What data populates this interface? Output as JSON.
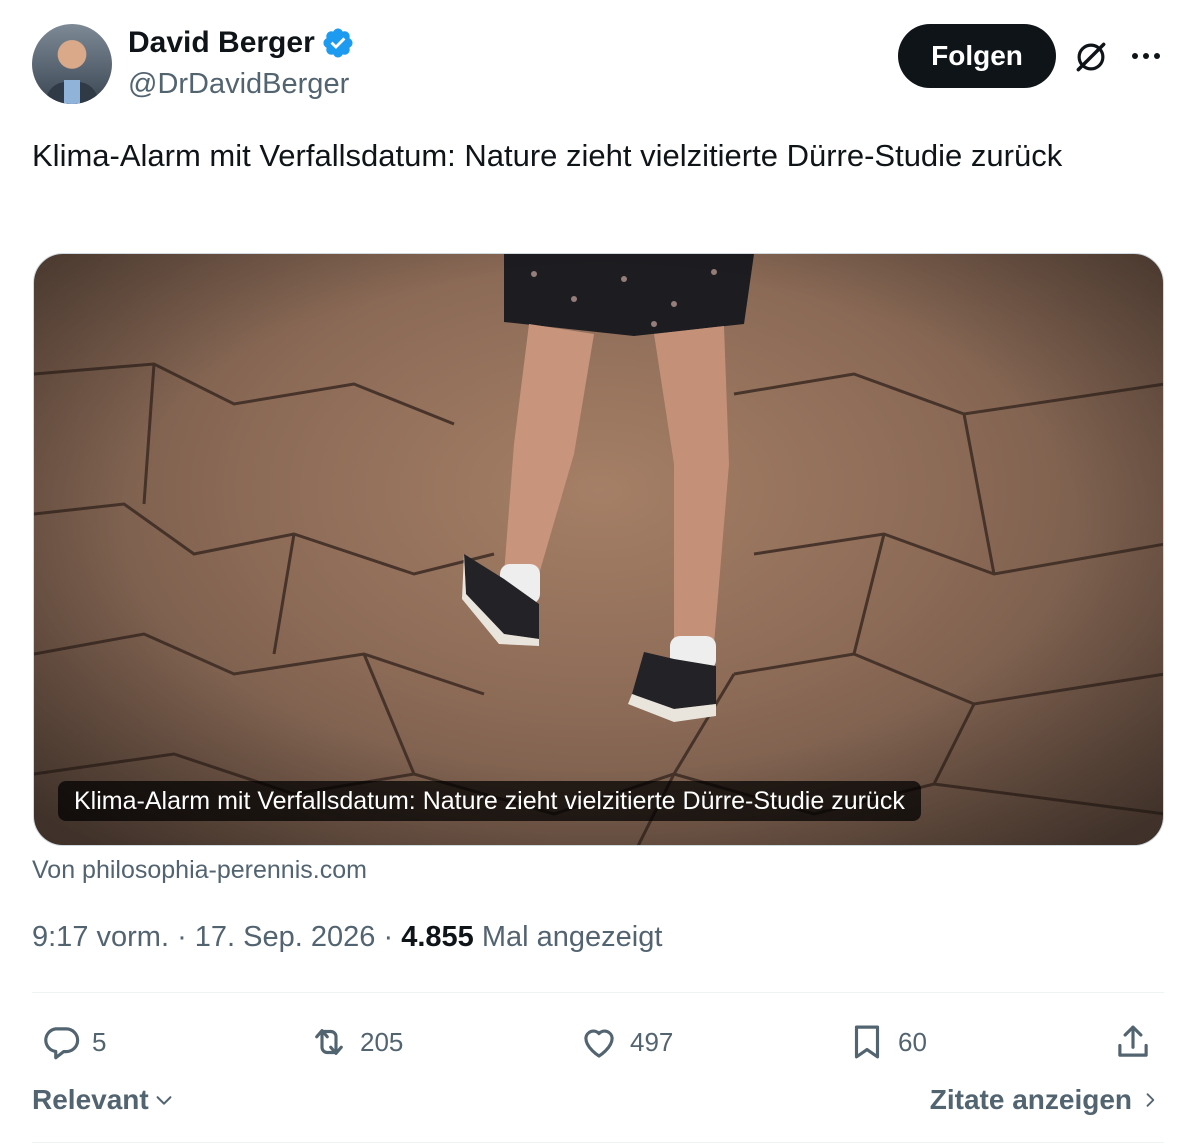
{
  "author": {
    "name": "David Berger",
    "handle": "@DrDavidBerger",
    "verified": true
  },
  "header": {
    "follow_label": "Folgen"
  },
  "tweet": {
    "text": "Klima-Alarm mit Verfallsdatum: Nature zieht vielzitierte Dürre-Studie zurück"
  },
  "card": {
    "caption": "Klima-Alarm mit Verfallsdatum: Nature zieht vielzitierte Dürre-Studie zurück",
    "source": "Von philosophia-perennis.com"
  },
  "meta": {
    "time": "9:17 vorm.",
    "sep1": "·",
    "date": "17. Sep. 2026",
    "sep2": "·",
    "views": "4.855",
    "views_label": "Mal angezeigt"
  },
  "actions": {
    "replies": "5",
    "reposts": "205",
    "likes": "497",
    "bookmarks": "60"
  },
  "footer": {
    "sort_label": "Relevant",
    "quotes_label": "Zitate anzeigen"
  },
  "colors": {
    "verified": "#1d9bf0",
    "primary_text": "#0f1419",
    "secondary_text": "#536471",
    "divider": "#eff3f4"
  }
}
